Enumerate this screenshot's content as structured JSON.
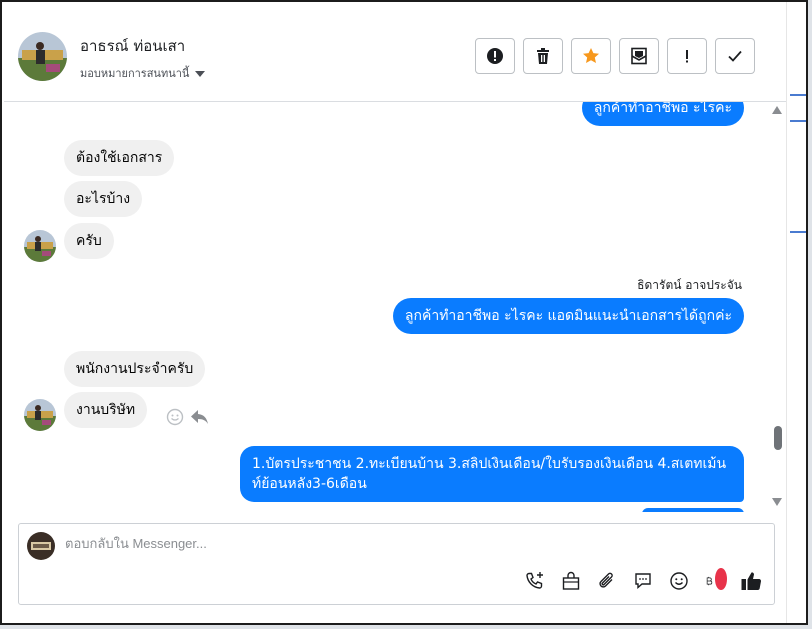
{
  "header": {
    "contact_name": "อาธรณ์ ท่อนเสา",
    "assign_label": "มอบหมายการสนทนานี้",
    "toolbar": [
      "mark-spam",
      "delete",
      "star",
      "mark-unread",
      "follow-up",
      "done"
    ]
  },
  "messages": {
    "partial_out": "ลูกค้าทำอาชีพอ ะไรคะ",
    "in1": "ต้องใช้เอกสาร",
    "in2": "อะไรบ้าง",
    "in3": "ครับ",
    "sender_name": "ธิดารัตน์ อาจประจัน",
    "out1": "ลูกค้าทำอาชีพอ ะไรคะ แอดมินแนะนำเอกสารได้ถูกค่ะ",
    "in4": "พนักงานประจำครับ",
    "in5": "งานบริษัท",
    "out2": "1.บัตรประชาชน 2.ทะเบียนบ้าน 3.สลิปเงินเดือน/ใบรับรองเงินเดือน  4.สเตทเม้นท์ย้อนหลัง3-6เดือน"
  },
  "composer": {
    "placeholder": "ตอบกลับใน Messenger...",
    "icons": [
      "call-add-icon",
      "shop-bag-icon",
      "paperclip-icon",
      "saved-reply-icon",
      "emoji-icon",
      "baht-icon",
      "like-icon"
    ]
  },
  "colors": {
    "accent": "#0a7cff",
    "star": "#f7981d",
    "incoming": "#f0f0f0"
  }
}
